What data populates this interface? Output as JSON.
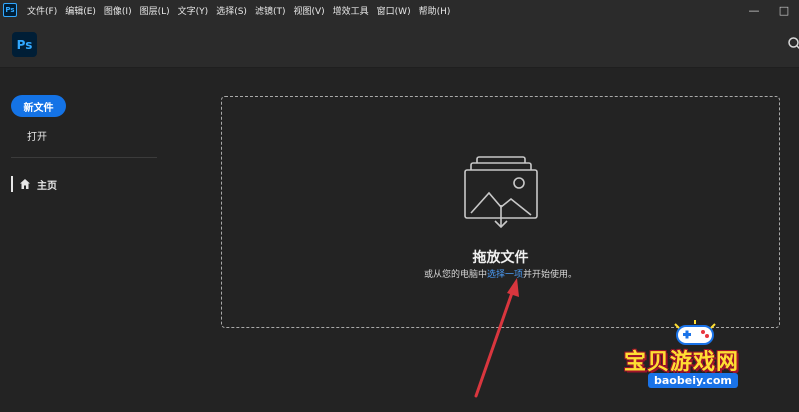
{
  "menubar": {
    "app_badge": "Ps",
    "items": [
      {
        "label": "文件(F)"
      },
      {
        "label": "编辑(E)"
      },
      {
        "label": "图像(I)"
      },
      {
        "label": "图层(L)"
      },
      {
        "label": "文字(Y)"
      },
      {
        "label": "选择(S)"
      },
      {
        "label": "滤镜(T)"
      },
      {
        "label": "视图(V)"
      },
      {
        "label": "增效工具"
      },
      {
        "label": "窗口(W)"
      },
      {
        "label": "帮助(H)"
      }
    ],
    "window_controls": [
      "—",
      "□"
    ]
  },
  "topbar": {
    "logo_text": "Ps",
    "search_icon": "search-icon"
  },
  "sidebar": {
    "new_file_label": "新文件",
    "open_label": "打开",
    "home_label": "主页",
    "home_icon": "home-icon"
  },
  "dropzone": {
    "title": "拖放文件",
    "subtitle_prefix": "或从您的电脑中",
    "subtitle_link": "选择一项",
    "subtitle_suffix": "并开始使用。",
    "icon": "image-stack-icon"
  },
  "watermark": {
    "title": "宝贝游戏网",
    "url": "baobeiy.com"
  },
  "colors": {
    "accent": "#1473e6",
    "link": "#4b9cf7",
    "ps_blue": "#31a8ff",
    "annotation_arrow": "#d9363e"
  }
}
